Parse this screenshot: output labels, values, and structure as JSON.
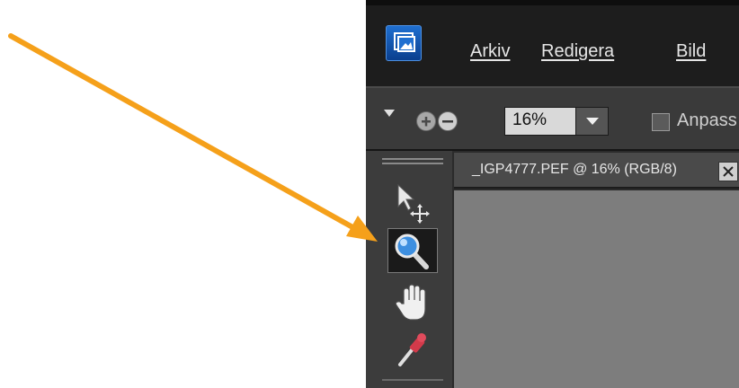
{
  "menu": {
    "items": [
      {
        "label": "Arkiv"
      },
      {
        "label": "Redigera"
      },
      {
        "label": "Bild"
      }
    ]
  },
  "options": {
    "zoom_value": "16%",
    "fit_label": "Anpass"
  },
  "document": {
    "tab_title": "_IGP4777.PEF @ 16% (RGB/8)"
  },
  "icons": {
    "app_logo": "photoshop-elements-icon",
    "zoom_in": "zoom-in-icon",
    "zoom_out": "zoom-out-icon",
    "move_tool": "move-tool-icon",
    "zoom_tool": "magnifier-icon",
    "hand_tool": "hand-icon",
    "eyedropper_tool": "eyedropper-icon",
    "close": "close-icon"
  },
  "colors": {
    "annotation_arrow": "#f5a01a",
    "menubar": "#1d1d1d",
    "optionsbar": "#3a3a3a",
    "canvas": "#7d7d7d",
    "accent_blue": "#1f6fd0"
  }
}
